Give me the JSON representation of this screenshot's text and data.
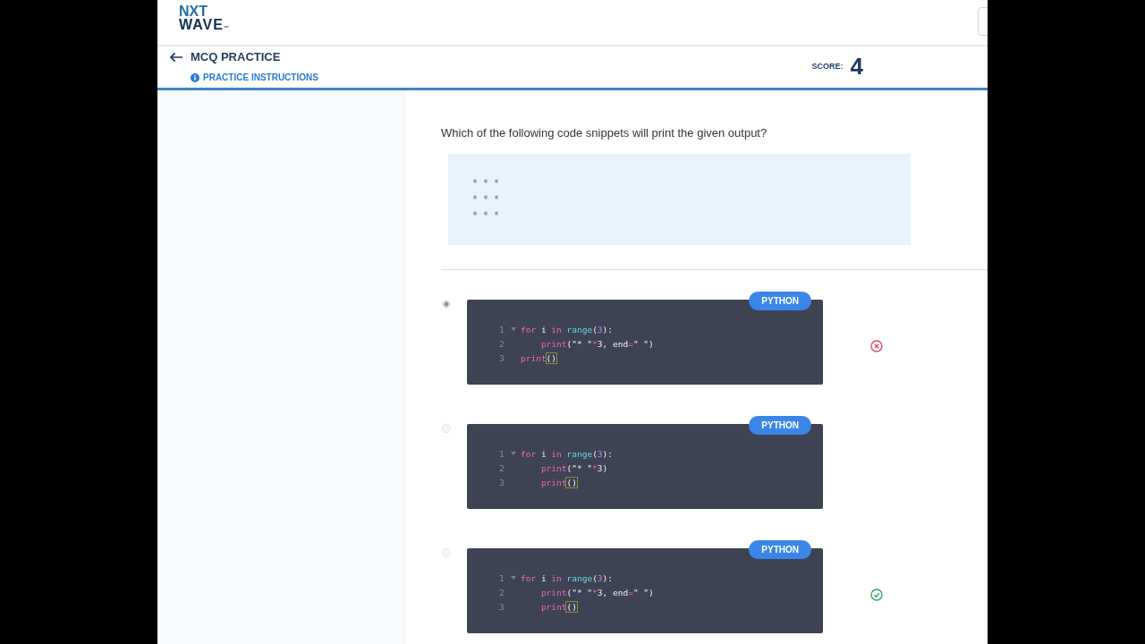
{
  "logo": {
    "line_1": "NXT",
    "line_2": "WAVE",
    "mark": "™"
  },
  "nav": {
    "title": "MCQ PRACTICE",
    "instructions_link": "PRACTICE INSTRUCTIONS",
    "score_label": "SCORE:",
    "score": "4"
  },
  "question": {
    "text": "Which of the following code snippets will print the given output?",
    "output_lines": [
      "* * *",
      "* * *",
      "* * *"
    ]
  },
  "options": [
    {
      "selected": true,
      "language": "PYTHON",
      "feedback_shown": true,
      "correct": false,
      "lines": [
        {
          "number": "1",
          "fold": true,
          "tokens": [
            {
              "text": "for",
              "kind": "kw"
            },
            {
              "text": " i ",
              "kind": "plain"
            },
            {
              "text": "in",
              "kind": "kw"
            },
            {
              "text": " range",
              "kind": "fn"
            },
            {
              "text": "(",
              "kind": "plain"
            },
            {
              "text": "3",
              "kind": "num"
            },
            {
              "text": "):",
              "kind": "plain"
            }
          ]
        },
        {
          "number": "2",
          "fold": false,
          "tokens": [
            {
              "text": "    print",
              "kind": "kw"
            },
            {
              "text": "(\"* \"",
              "kind": "plain"
            },
            {
              "text": "*",
              "kind": "op"
            },
            {
              "text": "3, end",
              "kind": "plain"
            },
            {
              "text": "=",
              "kind": "op"
            },
            {
              "text": "\" \")",
              "kind": "plain"
            }
          ]
        },
        {
          "number": "3",
          "fold": false,
          "tokens": [
            {
              "text": "print",
              "kind": "kw"
            },
            {
              "text": "()",
              "kind": "bracket"
            }
          ]
        }
      ]
    },
    {
      "selected": false,
      "language": "PYTHON",
      "feedback_shown": false,
      "lines": [
        {
          "number": "1",
          "fold": true,
          "tokens": [
            {
              "text": "for",
              "kind": "kw"
            },
            {
              "text": " i ",
              "kind": "plain"
            },
            {
              "text": "in",
              "kind": "kw"
            },
            {
              "text": " range",
              "kind": "fn"
            },
            {
              "text": "(",
              "kind": "plain"
            },
            {
              "text": "3",
              "kind": "num"
            },
            {
              "text": "):",
              "kind": "plain"
            }
          ]
        },
        {
          "number": "2",
          "fold": false,
          "tokens": [
            {
              "text": "    print",
              "kind": "kw"
            },
            {
              "text": "(\"* \"",
              "kind": "plain"
            },
            {
              "text": "*",
              "kind": "op"
            },
            {
              "text": "3)",
              "kind": "plain"
            }
          ]
        },
        {
          "number": "3",
          "fold": false,
          "tokens": [
            {
              "text": "    print",
              "kind": "kw"
            },
            {
              "text": "()",
              "kind": "bracket"
            }
          ]
        }
      ]
    },
    {
      "selected": false,
      "language": "PYTHON",
      "feedback_shown": true,
      "correct": true,
      "lines": [
        {
          "number": "1",
          "fold": true,
          "tokens": [
            {
              "text": "for",
              "kind": "kw"
            },
            {
              "text": " i ",
              "kind": "plain"
            },
            {
              "text": "in",
              "kind": "kw"
            },
            {
              "text": " range",
              "kind": "fn"
            },
            {
              "text": "(",
              "kind": "plain"
            },
            {
              "text": "3",
              "kind": "num"
            },
            {
              "text": "):",
              "kind": "plain"
            }
          ]
        },
        {
          "number": "2",
          "fold": false,
          "tokens": [
            {
              "text": "    print",
              "kind": "kw"
            },
            {
              "text": "(\"* \"",
              "kind": "plain"
            },
            {
              "text": "*",
              "kind": "op"
            },
            {
              "text": "3, end",
              "kind": "plain"
            },
            {
              "text": "=",
              "kind": "op"
            },
            {
              "text": "\" \")",
              "kind": "plain"
            }
          ]
        },
        {
          "number": "3",
          "fold": false,
          "tokens": [
            {
              "text": "    print",
              "kind": "kw"
            },
            {
              "text": "()",
              "kind": "bracket"
            }
          ]
        }
      ]
    }
  ]
}
